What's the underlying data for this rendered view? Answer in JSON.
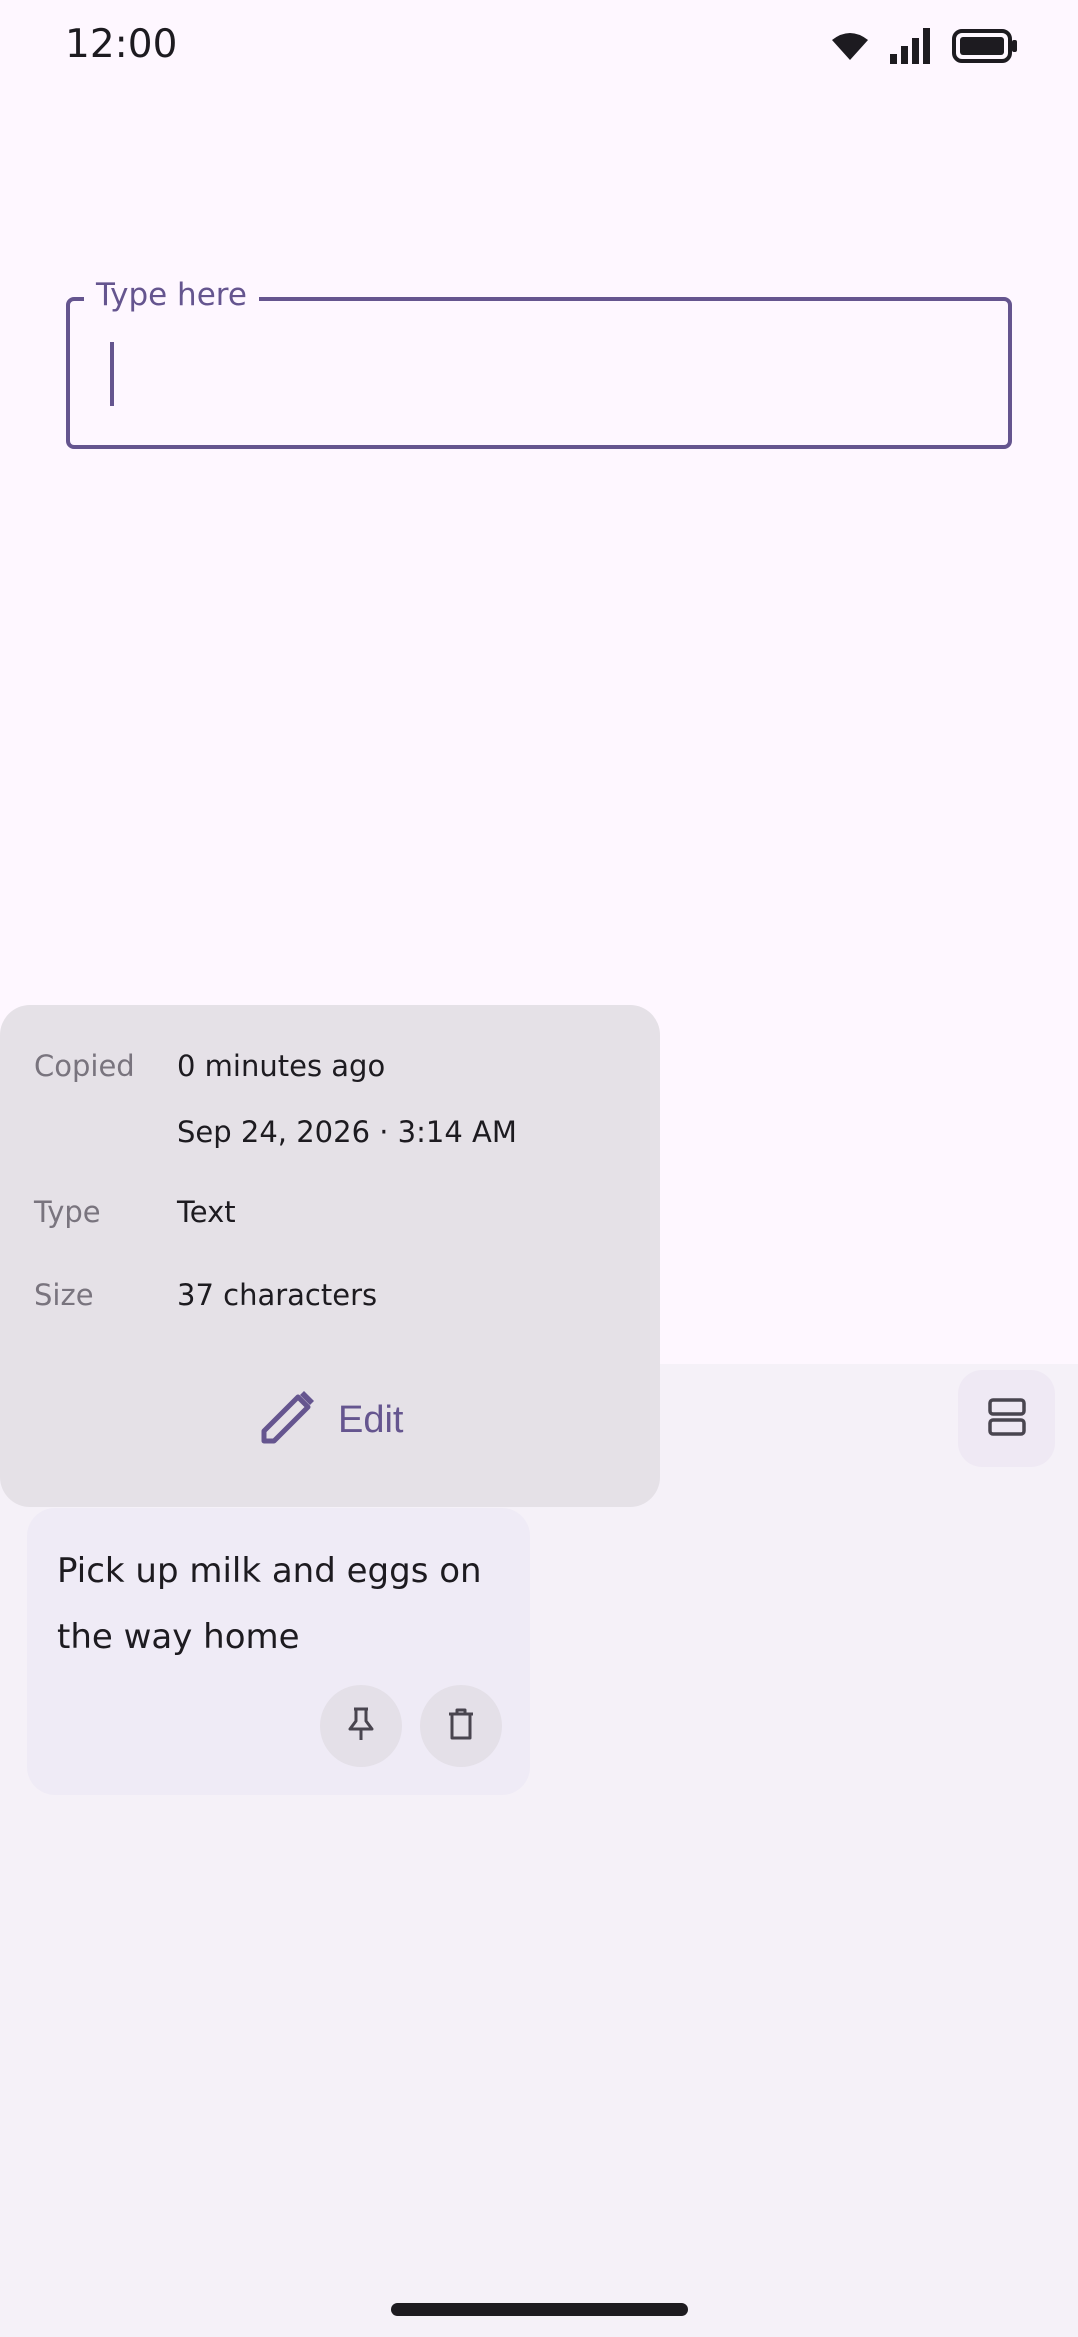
{
  "status_bar": {
    "time": "12:00",
    "icons": [
      "wifi-icon",
      "signal-icon",
      "battery-icon"
    ]
  },
  "input": {
    "label": "Type here",
    "value": ""
  },
  "details": {
    "rows": [
      {
        "label": "Copied",
        "value": "0 minutes ago"
      },
      {
        "label": "",
        "value": "Sep 24, 2026 · 3:14 AM"
      },
      {
        "label": "Type",
        "value": "Text"
      },
      {
        "label": "Size",
        "value": "37 characters"
      }
    ],
    "edit_label": "Edit",
    "edit_icon": "pencil-icon"
  },
  "clip": {
    "text": "Pick up milk and eggs on the way home",
    "actions": [
      "pin-icon",
      "delete-icon"
    ]
  },
  "toolbar": {
    "layout_icon": "view-agenda-icon"
  },
  "colors": {
    "accent": "#65558f",
    "background": "#fef7ff",
    "surface": "#f5f1f8",
    "popup": "#e5e1e7",
    "card": "#efebf6",
    "on_surface": "#1d1b20",
    "muted": "#79747e"
  }
}
